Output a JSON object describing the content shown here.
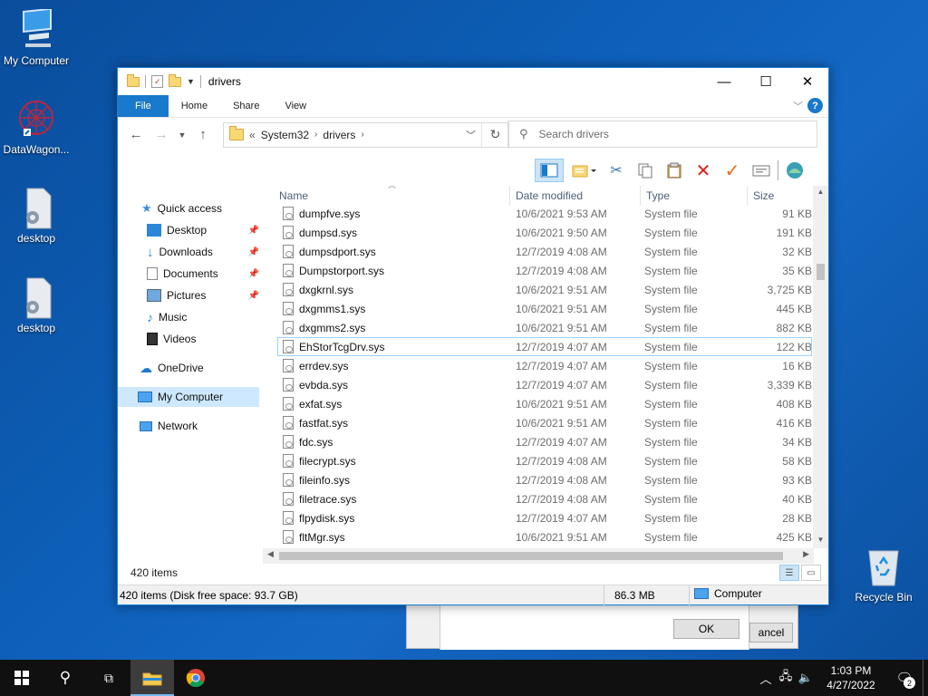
{
  "desktop": {
    "icons": [
      {
        "label": "My Computer"
      },
      {
        "label": "DataWagon..."
      },
      {
        "label": "desktop"
      },
      {
        "label": "desktop"
      },
      {
        "label": "Recycle Bin"
      }
    ]
  },
  "bg_dialog": {
    "ok_label": "OK",
    "cancel_label": "ancel"
  },
  "window": {
    "title": "drivers",
    "controls": {
      "minimize": "—",
      "maximize": "☐",
      "close": "✕"
    },
    "ribbon_tabs": [
      "File",
      "Home",
      "Share",
      "View"
    ],
    "address": {
      "prefix": "«",
      "crumbs": [
        "System32",
        "drivers"
      ]
    },
    "search_placeholder": "Search drivers",
    "nav": {
      "quick_access": "Quick access",
      "desktop": "Desktop",
      "downloads": "Downloads",
      "documents": "Documents",
      "pictures": "Pictures",
      "music": "Music",
      "videos": "Videos",
      "onedrive": "OneDrive",
      "my_computer": "My Computer",
      "network": "Network"
    },
    "columns": {
      "name": "Name",
      "date": "Date modified",
      "type": "Type",
      "size": "Size"
    },
    "files": [
      {
        "name": "dumpfve.sys",
        "date": "10/6/2021 9:53 AM",
        "type": "System file",
        "size": "91 KB"
      },
      {
        "name": "dumpsd.sys",
        "date": "10/6/2021 9:50 AM",
        "type": "System file",
        "size": "191 KB"
      },
      {
        "name": "dumpsdport.sys",
        "date": "12/7/2019 4:08 AM",
        "type": "System file",
        "size": "32 KB"
      },
      {
        "name": "Dumpstorport.sys",
        "date": "12/7/2019 4:08 AM",
        "type": "System file",
        "size": "35 KB"
      },
      {
        "name": "dxgkrnl.sys",
        "date": "10/6/2021 9:51 AM",
        "type": "System file",
        "size": "3,725 KB"
      },
      {
        "name": "dxgmms1.sys",
        "date": "10/6/2021 9:51 AM",
        "type": "System file",
        "size": "445 KB"
      },
      {
        "name": "dxgmms2.sys",
        "date": "10/6/2021 9:51 AM",
        "type": "System file",
        "size": "882 KB"
      },
      {
        "name": "EhStorTcgDrv.sys",
        "date": "12/7/2019 4:07 AM",
        "type": "System file",
        "size": "122 KB"
      },
      {
        "name": "errdev.sys",
        "date": "12/7/2019 4:07 AM",
        "type": "System file",
        "size": "16 KB"
      },
      {
        "name": "evbda.sys",
        "date": "12/7/2019 4:07 AM",
        "type": "System file",
        "size": "3,339 KB"
      },
      {
        "name": "exfat.sys",
        "date": "10/6/2021 9:51 AM",
        "type": "System file",
        "size": "408 KB"
      },
      {
        "name": "fastfat.sys",
        "date": "10/6/2021 9:51 AM",
        "type": "System file",
        "size": "416 KB"
      },
      {
        "name": "fdc.sys",
        "date": "12/7/2019 4:07 AM",
        "type": "System file",
        "size": "34 KB"
      },
      {
        "name": "filecrypt.sys",
        "date": "12/7/2019 4:08 AM",
        "type": "System file",
        "size": "58 KB"
      },
      {
        "name": "fileinfo.sys",
        "date": "12/7/2019 4:08 AM",
        "type": "System file",
        "size": "93 KB"
      },
      {
        "name": "filetrace.sys",
        "date": "12/7/2019 4:08 AM",
        "type": "System file",
        "size": "40 KB"
      },
      {
        "name": "flpydisk.sys",
        "date": "12/7/2019 4:07 AM",
        "type": "System file",
        "size": "28 KB"
      },
      {
        "name": "fltMgr.sys",
        "date": "10/6/2021 9:51 AM",
        "type": "System file",
        "size": "425 KB"
      }
    ],
    "item_count": "420 items",
    "status": {
      "summary": "420 items (Disk free space: 93.7 GB)",
      "size": "86.3 MB",
      "location": "Computer"
    }
  },
  "taskbar": {
    "time": "1:03 PM",
    "date": "4/27/2022",
    "notification_count": "2"
  },
  "colors": {
    "accent": "#1979ca",
    "taskbar": "#101010",
    "selection": "#cde8ff"
  }
}
